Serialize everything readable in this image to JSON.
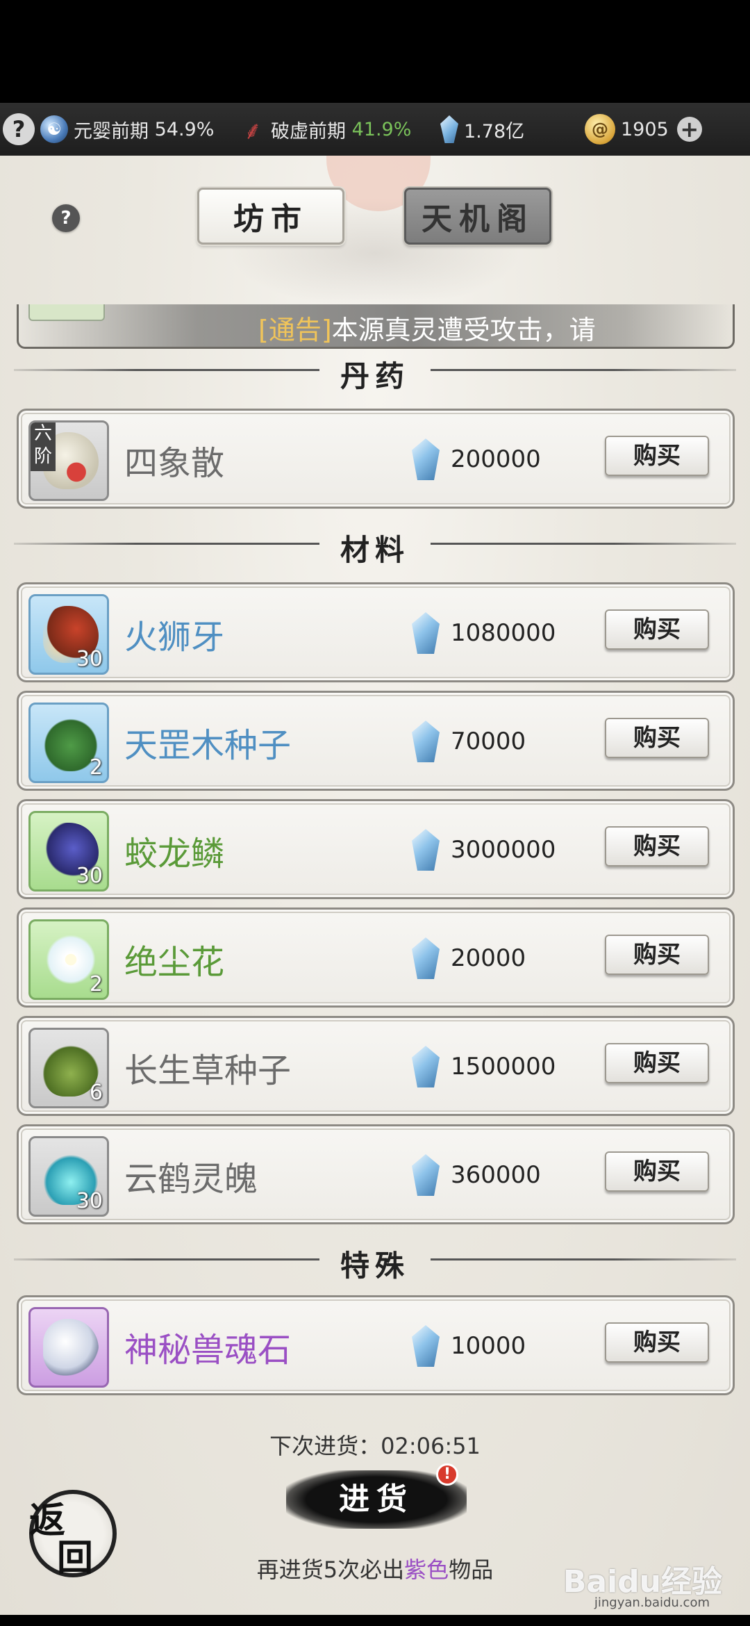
{
  "status": {
    "realm1": {
      "name": "元婴前期",
      "pct": "54.9%"
    },
    "realm2": {
      "name": "破虚前期",
      "pct": "41.9%"
    },
    "spirit_stones": "1.78亿",
    "gold": "1905"
  },
  "tabs": [
    {
      "label": "坊市",
      "active": true
    },
    {
      "label": "天机阁",
      "active": false
    }
  ],
  "ticker": {
    "tag": "[通告]",
    "text": "本源真灵遭受攻击，请"
  },
  "sections": {
    "pills": "丹药",
    "materials": "材料",
    "special": "特殊"
  },
  "items": [
    {
      "name": "四象散",
      "price": "200000",
      "tier": "六阶",
      "qty": "",
      "rarity": "grey",
      "buy": "购买"
    },
    {
      "name": "火狮牙",
      "price": "1080000",
      "qty": "30",
      "rarity": "blue",
      "buy": "购买"
    },
    {
      "name": "天罡木种子",
      "price": "70000",
      "qty": "2",
      "rarity": "blue",
      "buy": "购买"
    },
    {
      "name": "蛟龙鳞",
      "price": "3000000",
      "qty": "30",
      "rarity": "green",
      "buy": "购买"
    },
    {
      "name": "绝尘花",
      "price": "20000",
      "qty": "2",
      "rarity": "green",
      "buy": "购买"
    },
    {
      "name": "长生草种子",
      "price": "1500000",
      "qty": "6",
      "rarity": "grey",
      "buy": "购买"
    },
    {
      "name": "云鹤灵魄",
      "price": "360000",
      "qty": "30",
      "rarity": "grey",
      "buy": "购买"
    },
    {
      "name": "神秘兽魂石",
      "price": "10000",
      "qty": "",
      "rarity": "purple",
      "buy": "购买"
    }
  ],
  "restock": {
    "next_label": "下次进货：02:06:51",
    "button": "进货",
    "guarantee_pre": "再进货5次必出",
    "guarantee_color": "紫色",
    "guarantee_post": "物品"
  },
  "back_button": {
    "c1": "返",
    "c2": "回"
  },
  "watermark": {
    "brand": "Baidu经验",
    "url": "jingyan.baidu.com"
  },
  "colors": {
    "blue_rarity": "#4f8fc2",
    "green_rarity": "#5a9a38",
    "purple_rarity": "#9a4fc4",
    "accent_green": "#7ac25a"
  }
}
